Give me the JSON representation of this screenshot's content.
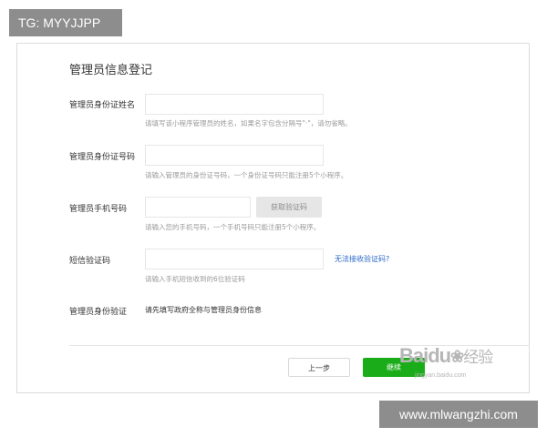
{
  "overlay": {
    "tag": "TG: MYYJJPP",
    "footer": "www.mlwangzhi.com"
  },
  "form": {
    "title": "管理员信息登记",
    "fields": [
      {
        "label": "管理员身份证姓名",
        "value": "",
        "hint": "请填写该小程序管理员的姓名，如果名字包含分隔号\"·\"，请勿省略。"
      },
      {
        "label": "管理员身份证号码",
        "value": "",
        "hint": "请输入管理员的身份证号码，一个身份证号码只能注册5个小程序。"
      },
      {
        "label": "管理员手机号码",
        "value": "",
        "hint": "请输入您的手机号码，一个手机号码只能注册5个小程序。",
        "action_label": "获取验证码"
      },
      {
        "label": "短信验证码",
        "value": "",
        "hint": "请输入手机短信收到的6位验证码",
        "link_label": "无法接收验证码?"
      }
    ],
    "verify": {
      "label": "管理员身份验证",
      "text": "请先填写政府全称与管理员身份信息"
    }
  },
  "buttons": {
    "prev": "上一步",
    "next": "继续"
  },
  "watermark": {
    "brand": "Baidu",
    "product": "经验",
    "url": "jingyan.baidu.com"
  },
  "colors": {
    "accent": "#1aad19",
    "link": "#2c69c8",
    "overlay_bg": "#8d8d8d"
  }
}
